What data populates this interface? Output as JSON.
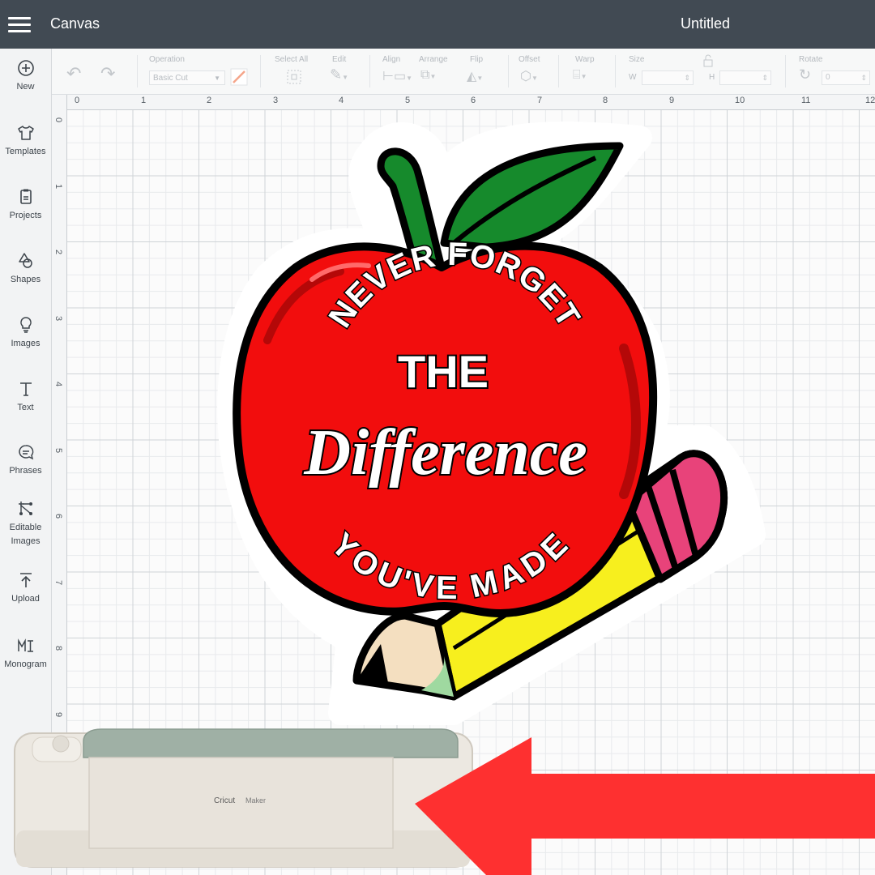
{
  "topbar": {
    "app_title": "Canvas",
    "doc_title": "Untitled"
  },
  "sidebar": {
    "items": [
      {
        "label": "New",
        "icon": "plus-circle-icon"
      },
      {
        "label": "Templates",
        "icon": "shirt-icon"
      },
      {
        "label": "Projects",
        "icon": "clipboard-icon"
      },
      {
        "label": "Shapes",
        "icon": "shapes-icon"
      },
      {
        "label": "Images",
        "icon": "lightbulb-icon"
      },
      {
        "label": "Text",
        "icon": "text-icon"
      },
      {
        "label": "Phrases",
        "icon": "speech-bubble-icon"
      },
      {
        "label": "Editable",
        "label2": "Images",
        "icon": "editable-images-icon"
      },
      {
        "label": "Upload",
        "icon": "upload-icon"
      },
      {
        "label": "Monogram",
        "icon": "monogram-icon"
      }
    ]
  },
  "toolbar": {
    "operation_label": "Operation",
    "operation_value": "Basic Cut",
    "select_all_label": "Select All",
    "edit_label": "Edit",
    "align_label": "Align",
    "arrange_label": "Arrange",
    "flip_label": "Flip",
    "offset_label": "Offset",
    "warp_label": "Warp",
    "size_label": "Size",
    "width_prefix": "W",
    "height_prefix": "H",
    "rotate_label": "Rotate",
    "rotate_value": "0"
  },
  "ruler": {
    "top": [
      "0",
      "1",
      "2",
      "3",
      "4",
      "5",
      "6",
      "7",
      "8",
      "9",
      "10",
      "11",
      "12"
    ],
    "left": [
      "0",
      "1",
      "2",
      "3",
      "4",
      "5",
      "6",
      "7",
      "8",
      "9"
    ]
  },
  "artwork": {
    "line1": "NEVER FORGET",
    "line2": "THE",
    "line3": "Difference",
    "line4": "YOU'VE MADE"
  },
  "machine": {
    "brand": "Cricut",
    "model": "Maker"
  },
  "colors": {
    "topbar": "#414a53",
    "apple_red": "#f20d0d",
    "leaf_green": "#168a2c",
    "pencil_yellow": "#f7ef1e",
    "eraser_pink": "#e8437a",
    "arrow_red": "#fe3030"
  }
}
